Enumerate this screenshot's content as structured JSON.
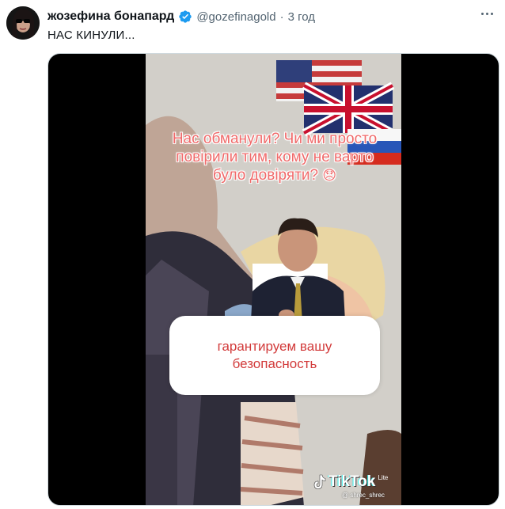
{
  "tweet": {
    "display_name": "жозефина бонапард",
    "handle": "@gozefinagold",
    "separator": "·",
    "time": "3 год",
    "text": "НАС КИНУЛИ..."
  },
  "video": {
    "caption": "Нас обманули? Чи ми просто повірили тим, кому не варто було довіряти?",
    "caption_emoji": "😞",
    "quote": "гарантируем вашу безопасность",
    "watermark_brand": "TikTok",
    "watermark_suffix": "Lite",
    "watermark_handle": "@ shrec_shrec"
  },
  "colors": {
    "accent_verified": "#1d9bf0",
    "caption_text": "#f06a6a",
    "quote_text": "#d23a3a"
  },
  "icons": {
    "verified": "verified-badge-icon",
    "more": "more-options-icon"
  }
}
